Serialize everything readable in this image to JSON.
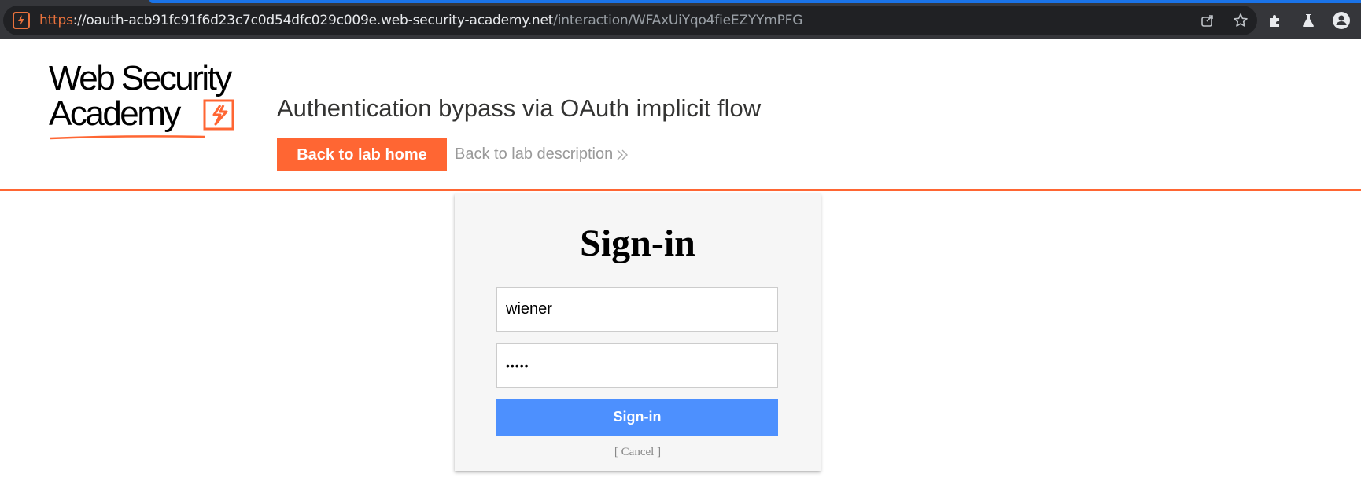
{
  "browser": {
    "url_scheme": "https",
    "url_separator": "://",
    "url_host": "oauth-acb91fc91f6d23c7c0d54dfc029c009e.web-security-academy.net",
    "url_path": "/interaction/WFAxUiYqo4fieEZYYmPFG",
    "icons": [
      "site-info-icon",
      "share-icon",
      "bookmark-star-icon",
      "extensions-icon",
      "labs-icon",
      "profile-icon"
    ]
  },
  "header": {
    "logo_line1": "Web Security",
    "logo_line2": "Academy",
    "lab_title": "Authentication bypass via OAuth implicit flow",
    "back_home_label": "Back to lab home",
    "back_description_label": "Back to lab description"
  },
  "signin": {
    "title": "Sign-in",
    "username_value": "wiener",
    "password_mask": "•••••",
    "button_label": "Sign-in",
    "cancel_label": "[ Cancel ]"
  },
  "colors": {
    "accent": "#ff6633",
    "button_blue": "#4d90fe"
  }
}
